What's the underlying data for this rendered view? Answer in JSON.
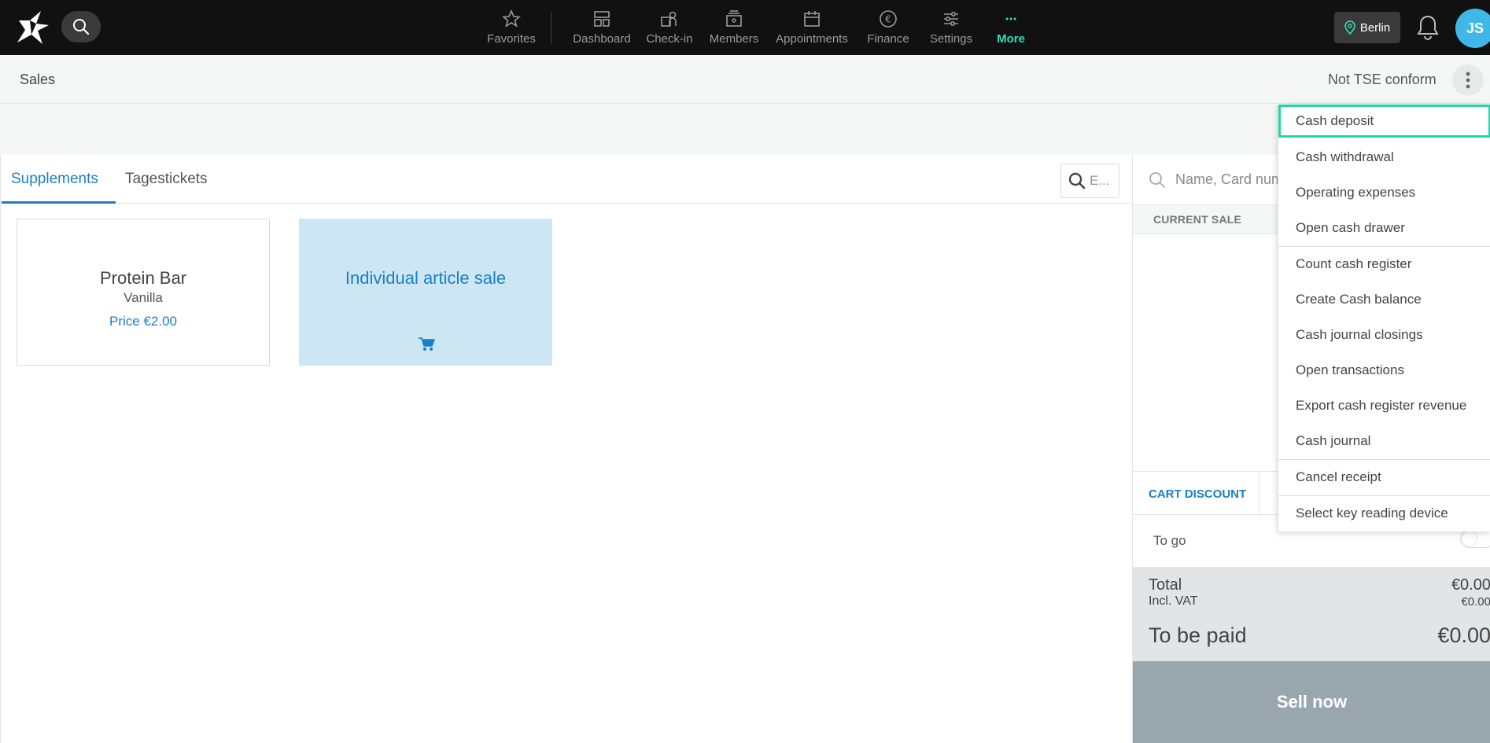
{
  "topbar": {
    "nav": [
      {
        "label": "Favorites",
        "icon": "star-icon"
      },
      {
        "label": "Dashboard",
        "icon": "dashboard-icon"
      },
      {
        "label": "Check-in",
        "icon": "check-in-icon"
      },
      {
        "label": "Members",
        "icon": "members-icon"
      },
      {
        "label": "Appointments",
        "icon": "calendar-icon"
      },
      {
        "label": "Finance",
        "icon": "euro-icon"
      },
      {
        "label": "Settings",
        "icon": "sliders-icon"
      },
      {
        "label": "More",
        "icon": "more-dots-icon"
      }
    ],
    "location": "Berlin",
    "avatar": "JS",
    "accent": "#2ee0b5"
  },
  "header": {
    "title": "Sales",
    "tse_status": "Not TSE conform"
  },
  "tabs": [
    {
      "label": "Supplements"
    },
    {
      "label": "Tagestickets"
    }
  ],
  "filter": {
    "placeholder": "E..."
  },
  "products": [
    {
      "name": "Protein Bar",
      "variant": "Vanilla",
      "price": "Price €2.00"
    },
    {
      "name": "Individual article sale"
    }
  ],
  "cart": {
    "search_placeholder": "Name, Card num",
    "current_sale": "CURRENT SALE",
    "discount": "CART DISCOUNT",
    "to_go": "To go",
    "total_label": "Total",
    "total_value": "€0.00",
    "vat_label": "Incl. VAT",
    "vat_value": "€0.00",
    "pay_label": "To be paid",
    "pay_value": "€0.00",
    "sell": "Sell now"
  },
  "menu": [
    {
      "label": "Cash deposit"
    },
    {
      "label": "Cash withdrawal"
    },
    {
      "label": "Operating expenses"
    },
    {
      "label": "Open cash drawer"
    },
    {
      "label": "Count cash register"
    },
    {
      "label": "Create Cash balance"
    },
    {
      "label": "Cash journal closings"
    },
    {
      "label": "Open transactions"
    },
    {
      "label": "Export cash register revenue"
    },
    {
      "label": "Cash journal"
    },
    {
      "label": "Cancel receipt"
    },
    {
      "label": "Select key reading device"
    }
  ]
}
